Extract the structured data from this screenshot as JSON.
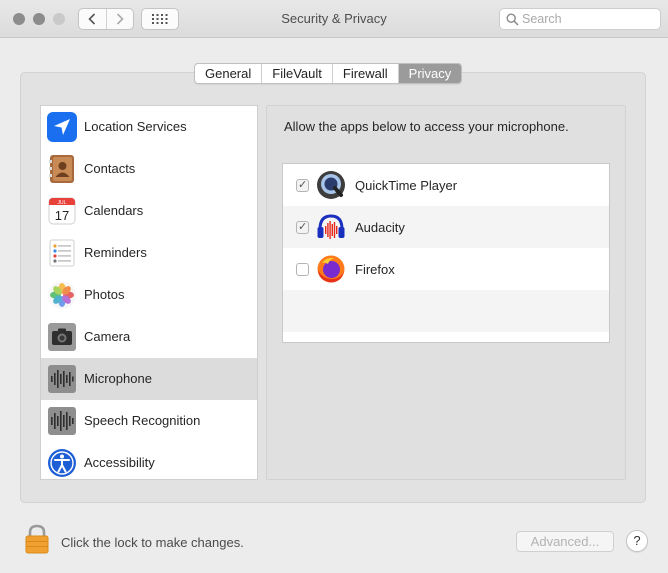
{
  "window": {
    "title": "Security & Privacy"
  },
  "search": {
    "placeholder": "Search"
  },
  "tabs": [
    {
      "label": "General"
    },
    {
      "label": "FileVault"
    },
    {
      "label": "Firewall"
    },
    {
      "label": "Privacy",
      "selected": true
    }
  ],
  "sidebar": {
    "items": [
      {
        "label": "Location Services",
        "icon": "location-arrow-icon"
      },
      {
        "label": "Contacts",
        "icon": "contacts-book-icon"
      },
      {
        "label": "Calendars",
        "icon": "calendar-icon"
      },
      {
        "label": "Reminders",
        "icon": "reminders-list-icon"
      },
      {
        "label": "Photos",
        "icon": "photos-flower-icon"
      },
      {
        "label": "Camera",
        "icon": "camera-icon"
      },
      {
        "label": "Microphone",
        "icon": "microphone-waveform-icon",
        "selected": true
      },
      {
        "label": "Speech Recognition",
        "icon": "speech-waveform-icon"
      },
      {
        "label": "Accessibility",
        "icon": "accessibility-icon"
      }
    ],
    "calendar_month": "JUL",
    "calendar_day": "17"
  },
  "detail": {
    "heading": "Allow the apps below to access your microphone.",
    "apps": [
      {
        "name": "QuickTime Player",
        "checked": true,
        "icon": "quicktime-icon"
      },
      {
        "name": "Audacity",
        "checked": true,
        "icon": "audacity-icon"
      },
      {
        "name": "Firefox",
        "checked": false,
        "icon": "firefox-icon"
      }
    ]
  },
  "footer": {
    "lock_text": "Click the lock to make changes.",
    "advanced_label": "Advanced...",
    "help_label": "?"
  },
  "colors": {
    "window_bg": "#ececec",
    "selected_tab": "#9b9b9b",
    "selected_row": "#dcdcdc",
    "location_blue": "#1a6ff0",
    "lock_orange": "#f0a030"
  }
}
